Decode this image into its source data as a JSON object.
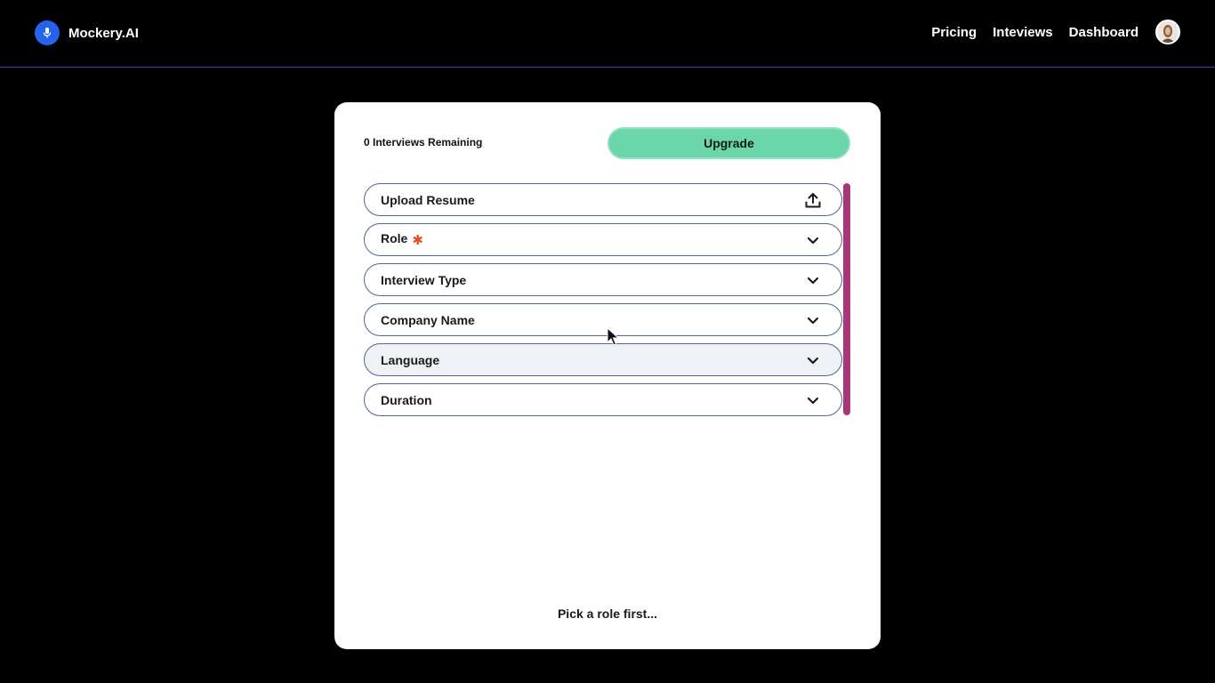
{
  "header": {
    "brand_name": "Mockery.AI",
    "brand_icon": "microphone-icon",
    "nav": [
      {
        "label": "Pricing"
      },
      {
        "label": "Inteviews"
      },
      {
        "label": "Dashboard"
      }
    ],
    "avatar": "user-avatar"
  },
  "card": {
    "remaining_text": "0 Interviews Remaining",
    "upgrade_label": "Upgrade",
    "fields": [
      {
        "label": "Upload Resume",
        "icon": "upload-icon"
      },
      {
        "label": "Role",
        "required_mark": "✱",
        "icon": "chevron-down-icon"
      },
      {
        "label": "Interview Type",
        "icon": "chevron-down-icon"
      },
      {
        "label": "Company Name",
        "icon": "chevron-down-icon"
      },
      {
        "label": "Language",
        "icon": "chevron-down-icon"
      },
      {
        "label": "Duration",
        "icon": "chevron-down-icon"
      }
    ],
    "hint_text": "Pick a role first..."
  },
  "colors": {
    "accent": "#2563eb",
    "upgrade": "#6ad6a9",
    "scrollbar": "#a8377a",
    "required": "#ea4b28",
    "field_border": "#4f6692"
  }
}
